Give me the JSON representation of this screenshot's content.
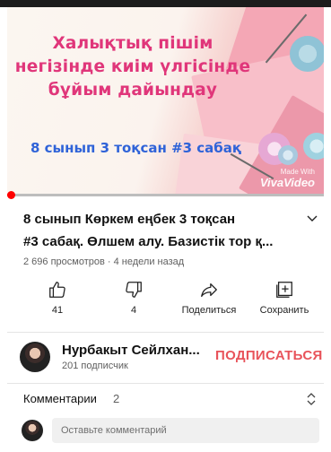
{
  "video": {
    "thumbnail_lines": [
      "Халықтық пішім",
      "негізінде киім үлгісінде",
      "бұйым дайындау"
    ],
    "thumbnail_subtitle": "8 сынып 3 тоқсан #3 сабақ",
    "watermark_small": "Made With",
    "watermark_brand": "VivaVideo",
    "progress_fraction": 0.01,
    "title_line1": "8 сынып Көркем еңбек 3 тоқсан",
    "title_line2": "#3 сабақ. Өлшем алу. Базистік тор қ...",
    "meta": "2 696 просмотров · 4 недели назад"
  },
  "actions": {
    "like": {
      "label": "41",
      "icon": "thumb-up-icon"
    },
    "dislike": {
      "label": "4",
      "icon": "thumb-down-icon"
    },
    "share": {
      "label": "Поделиться",
      "icon": "share-icon"
    },
    "save": {
      "label": "Сохранить",
      "icon": "add-to-playlist-icon"
    }
  },
  "channel": {
    "name": "Нурбакыт Сейлхан...",
    "subscribers": "201 подписчик",
    "subscribe_label": "ПОДПИСАТЬСЯ"
  },
  "comments": {
    "label": "Комментарии",
    "count": "2",
    "placeholder": "Оставьте комментарий"
  },
  "colors": {
    "accent_red": "#ff0000",
    "subscribe": "#e8535a",
    "thumbnail_title": "#e0367a",
    "thumbnail_subtitle": "#2f63d8"
  }
}
